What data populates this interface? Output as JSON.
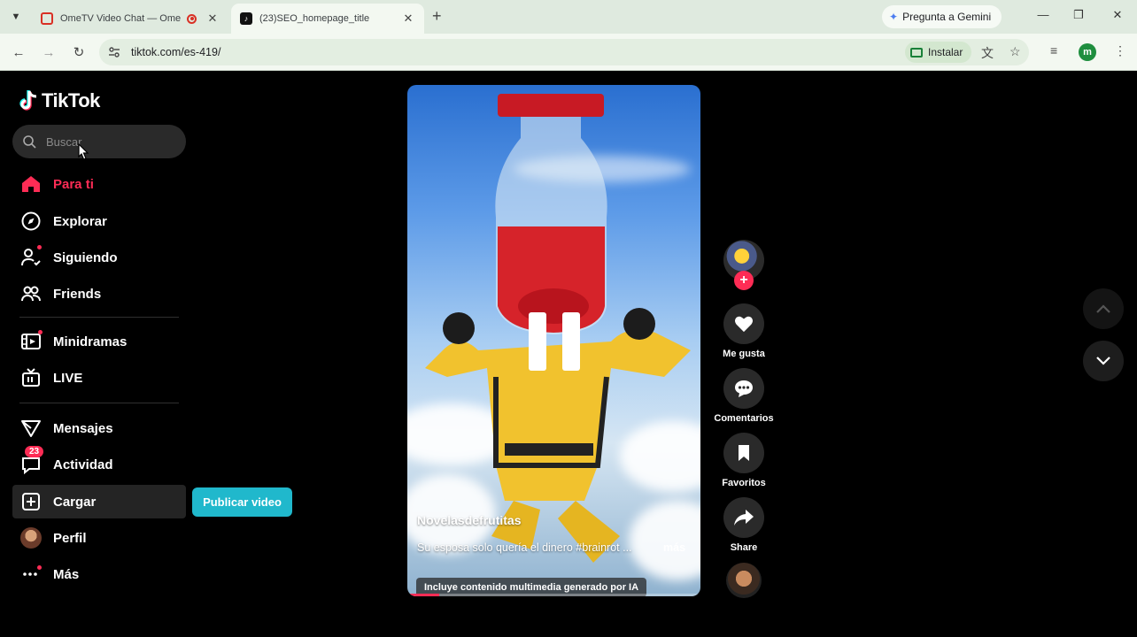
{
  "browser": {
    "tabs": [
      {
        "title": "OmeTV Video Chat — Ome",
        "active": false
      },
      {
        "title": "(23)SEO_homepage_title",
        "active": true
      }
    ],
    "new_tab": "+",
    "gemini_label": "Pregunta a Gemini",
    "url": "tiktok.com/es-419/",
    "install_label": "Instalar",
    "profile_initial": "m"
  },
  "tiktok": {
    "logo": "TikTok",
    "search_placeholder": "Buscar",
    "nav": [
      {
        "label": "Para ti",
        "icon": "home-icon"
      },
      {
        "label": "Explorar",
        "icon": "compass-icon"
      },
      {
        "label": "Siguiendo",
        "icon": "following-icon"
      },
      {
        "label": "Friends",
        "icon": "friends-icon"
      },
      {
        "label": "Minidramas",
        "icon": "film-icon"
      },
      {
        "label": "LIVE",
        "icon": "live-tv-icon"
      },
      {
        "label": "Mensajes",
        "icon": "send-icon"
      },
      {
        "label": "Actividad",
        "icon": "message-icon",
        "badge": "23"
      },
      {
        "label": "Cargar",
        "icon": "upload-icon"
      },
      {
        "label": "Perfil",
        "icon": "avatar"
      },
      {
        "label": "Más",
        "icon": "more-icon"
      }
    ],
    "publish_button": "Publicar video",
    "video": {
      "author": "Novelasdefrutitas",
      "caption": "Su esposa solo quería el dinero #brainrot ...",
      "more": "más",
      "ai_label": "Incluye contenido multimedia generado por IA",
      "progress": 0.11
    },
    "actions": {
      "like": "Me gusta",
      "comments": "Comentarios",
      "favorites": "Favoritos",
      "share": "Share"
    },
    "colors": {
      "accent": "#fe2c55",
      "publish": "#20b8cc"
    }
  }
}
